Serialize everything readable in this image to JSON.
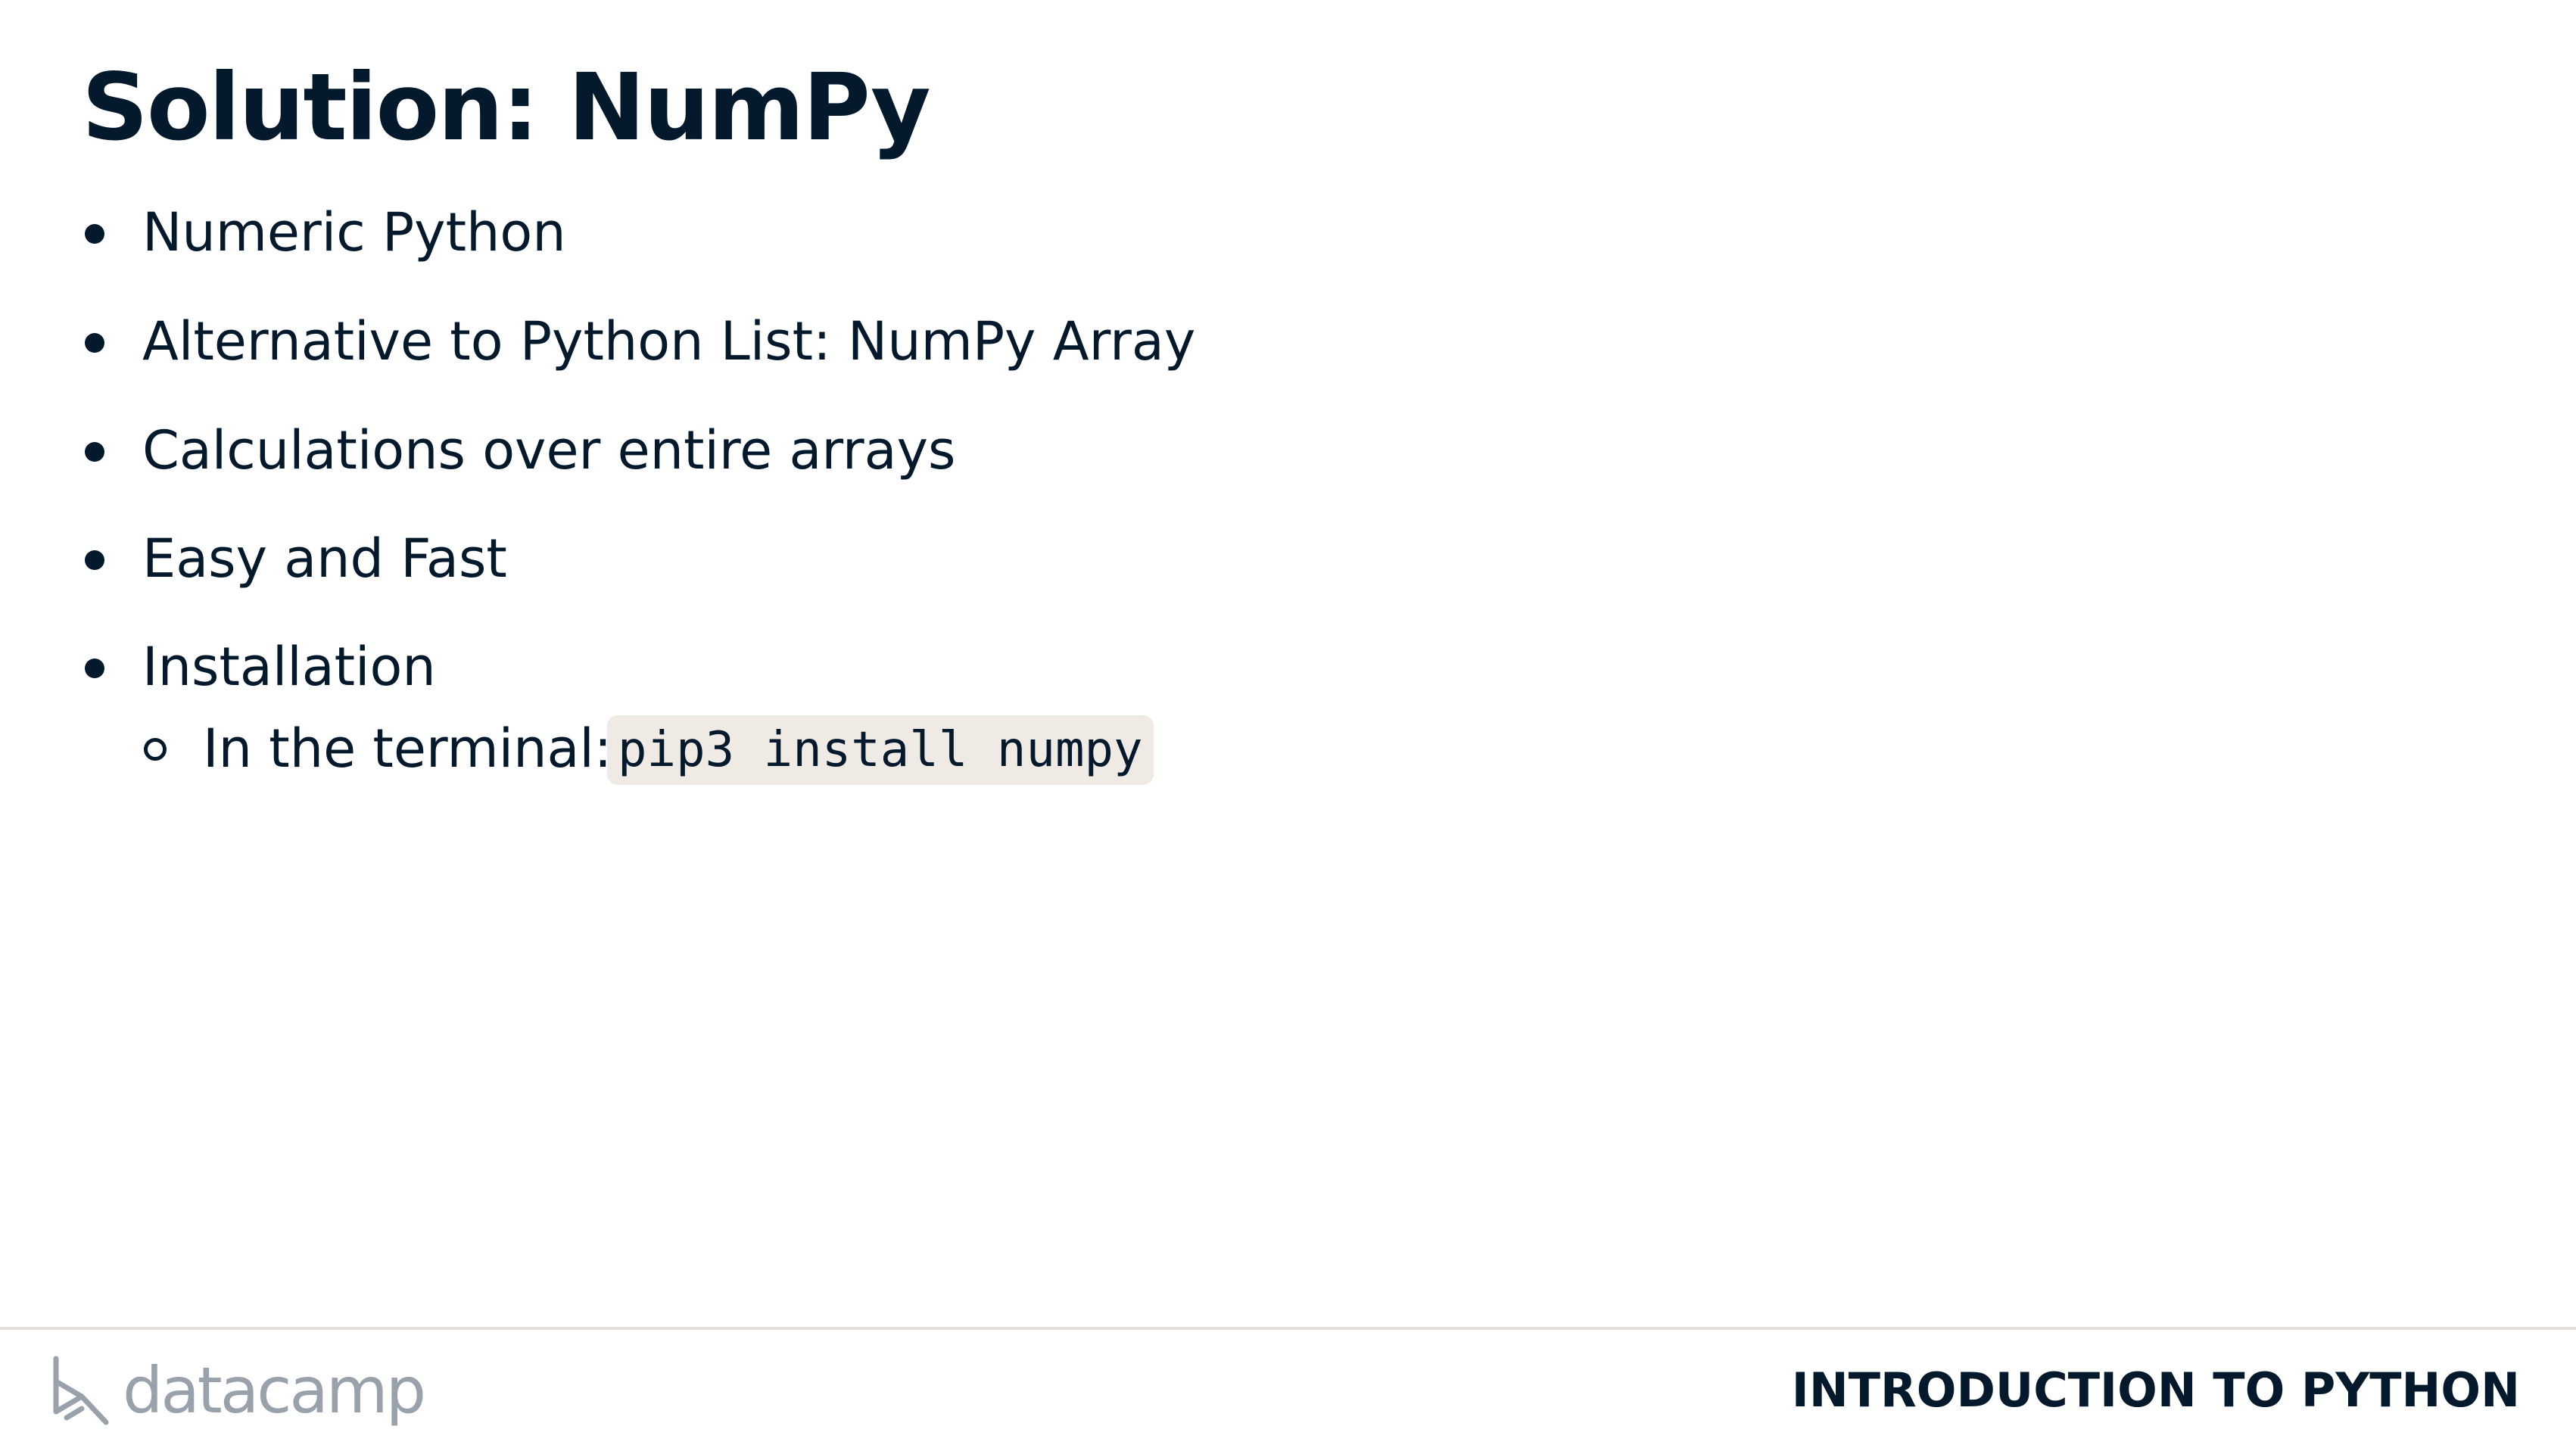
{
  "slide": {
    "title": "Solution: NumPy",
    "bullets": [
      "Numeric Python",
      "Alternative to Python List: NumPy Array",
      "Calculations over entire arrays",
      "Easy and Fast",
      "Installation"
    ],
    "sub_bullet": {
      "label": "In the terminal:",
      "code": "pip3 install numpy"
    }
  },
  "footer": {
    "brand": "datacamp",
    "brand_icon": "datacamp-logo-icon",
    "course": "INTRODUCTION TO PYTHON"
  },
  "colors": {
    "text": "#05192d",
    "code_background": "#efebe4",
    "logo_gray": "#99a2ab",
    "divider": "#e5e1da"
  }
}
